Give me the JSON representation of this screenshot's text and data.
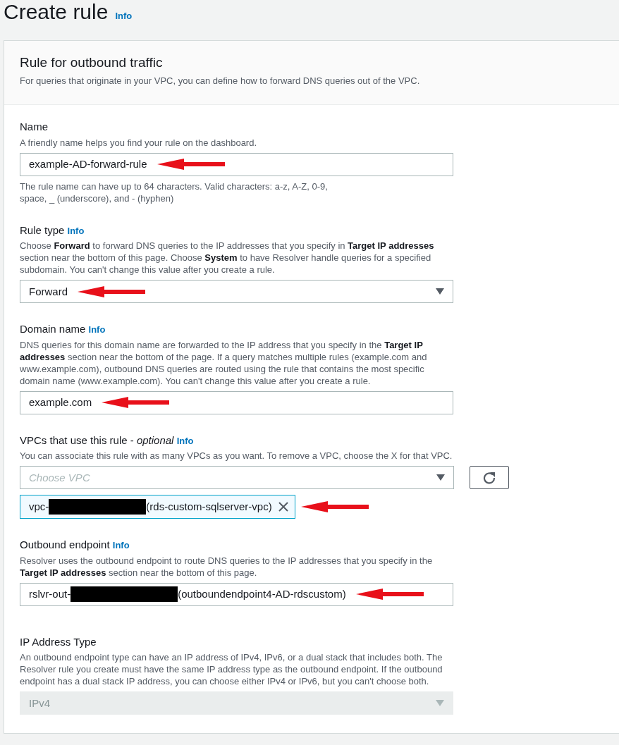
{
  "page": {
    "title": "Create rule",
    "info": "Info"
  },
  "panel": {
    "title": "Rule for outbound traffic",
    "description": "For queries that originate in your VPC, you can define how to forward DNS queries out of the VPC."
  },
  "fields": [
    {
      "kind": "text",
      "label": "Name",
      "description": "A friendly name helps you find your rule on the dashboard.",
      "value": "example-AD-forward-rule",
      "arrow": true,
      "constraint": "The rule name can have up to 64 characters. Valid characters: a-z, A-Z, 0-9, space, _ (underscore), and - (hyphen)"
    },
    {
      "kind": "select",
      "label": "Rule type",
      "info": "Info",
      "description": "Choose **Forward** to forward DNS queries to the IP addresses that you specify in **Target IP addresses** section near the bottom of this page. Choose **System** to have Resolver handle queries for a specified subdomain. You can't change this value after you create a rule.",
      "value": "Forward",
      "arrow": true,
      "disabled": false
    },
    {
      "kind": "text",
      "label": "Domain name",
      "info": "Info",
      "description": "DNS queries for this domain name are forwarded to the IP address that you specify in the **Target IP addresses** section near the bottom of the page. If a query matches multiple rules (example.com and www.example.com), outbound DNS queries are routed using the rule that contains the most specific domain name (www.example.com). You can't change this value after you create a rule.",
      "value": "example.com",
      "arrow": true
    },
    {
      "kind": "multiselect",
      "label": "VPCs that use this rule - *optional*",
      "info": "Info",
      "description": "You can associate this rule with as many VPCs as you want. To remove a VPC, choose the X for that VPC.",
      "placeholder": "Choose VPC",
      "tokens": [
        {
          "prefix": "vpc-",
          "redacted": true,
          "suffix": "(rds-custom-sqlserver-vpc)",
          "arrow": true
        }
      ]
    },
    {
      "kind": "redacted",
      "label": "Outbound endpoint",
      "info": "Info",
      "description": "Resolver uses the outbound endpoint to route DNS queries to the IP addresses that you specify in the **Target IP addresses** section near the bottom of this page.",
      "prefix": "rslvr-out-",
      "suffix": "(outboundendpoint4-AD-rdscustom)",
      "arrow": true
    },
    {
      "kind": "select",
      "label": "IP Address Type",
      "description": "An outbound endpoint type can have an IP address of IPv4, IPv6, or a dual stack that includes both. The Resolver rule you create must have the same IP address type as the outbound endpoint. If the outbound endpoint has a dual stack IP address, you can choose either IPv4 or IPv6, but you can't choose both.",
      "value": "IPv4",
      "disabled": true
    }
  ]
}
